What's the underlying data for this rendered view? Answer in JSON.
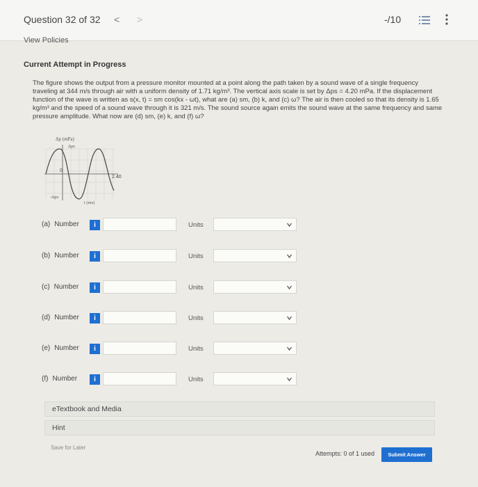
{
  "header": {
    "question_label": "Question 32 of 32",
    "prev_symbol": "<",
    "next_symbol": ">",
    "score": "-/10",
    "icons": [
      "list-icon",
      "kebab-menu-icon"
    ]
  },
  "view_policies": "View Policies",
  "attempt_title": "Current Attempt in Progress",
  "problem": {
    "p1": "The figure shows the output from a pressure monitor mounted at a point along the path taken by a sound wave of a single frequency traveling at 344 m/s through air with a uniform density of 1.71 kg/m³. The vertical axis scale is set by Δps = 4.20 mPa. If the displacement function of the wave is written as s(x, t) = sm cos(kx - ωt), what are (a) sm, (b) k, and (c) ω? The air is then cooled so that its density is 1.65 kg/m³ and the speed of a sound wave through it is 321 m/s. The sound source again emits the sound wave at the same frequency and same pressure amplitude. What now are (d) sm, (e) k, and (f) ω?"
  },
  "figure": {
    "y_label": "Δp (mPa)",
    "top_label": "Δps",
    "bottom_label": "-Δps",
    "origin_label": "0",
    "x_tick": "2.40",
    "x_label": "t (ms)"
  },
  "answers": [
    {
      "part": "(a)",
      "word": "Number",
      "info": "i",
      "value": "",
      "units_label": "Units",
      "units_value": ""
    },
    {
      "part": "(b)",
      "word": "Number",
      "info": "i",
      "value": "",
      "units_label": "Units",
      "units_value": ""
    },
    {
      "part": "(c)",
      "word": "Number",
      "info": "i",
      "value": "",
      "units_label": "Units",
      "units_value": ""
    },
    {
      "part": "(d)",
      "word": "Number",
      "info": "i",
      "value": "",
      "units_label": "Units",
      "units_value": ""
    },
    {
      "part": "(e)",
      "word": "Number",
      "info": "i",
      "value": "",
      "units_label": "Units",
      "units_value": ""
    },
    {
      "part": "(f)",
      "word": "Number",
      "info": "i",
      "value": "",
      "units_label": "Units",
      "units_value": ""
    }
  ],
  "etextbook": "eTextbook and Media",
  "hint": "Hint",
  "footer": {
    "save_later": "Save for Later",
    "attempts": "Attempts: 0 of 1 used",
    "submit": "Submit Answer"
  },
  "colors": {
    "accent": "#1f6fd1",
    "background": "#ecebe6"
  }
}
